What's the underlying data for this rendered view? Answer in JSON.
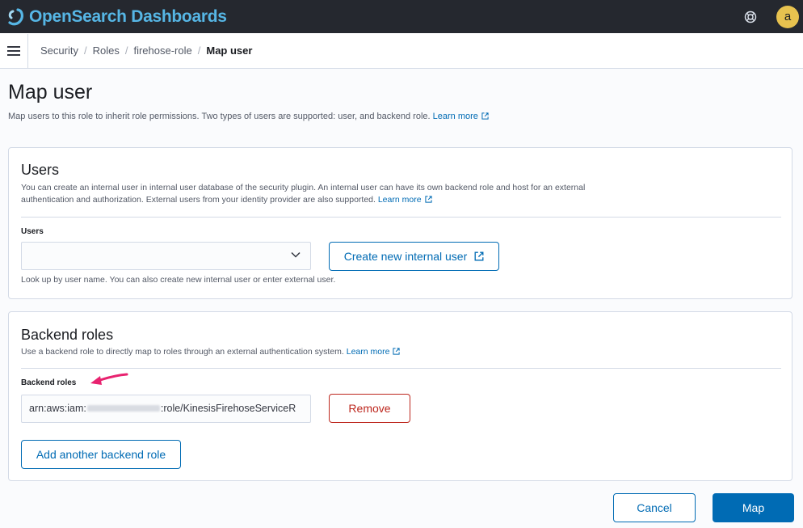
{
  "app": {
    "brand": "OpenSearch Dashboards",
    "avatar_initial": "a"
  },
  "breadcrumbs": [
    "Security",
    "Roles",
    "firehose-role",
    "Map user"
  ],
  "page": {
    "title": "Map user",
    "description": "Map users to this role to inherit role permissions. Two types of users are supported: user, and backend role.",
    "learn_more": "Learn more"
  },
  "users_panel": {
    "title": "Users",
    "description": "You can create an internal user in internal user database of the security plugin. An internal user can have its own backend role and host for an external authentication and authorization. External users from your identity provider are also supported.",
    "learn_more": "Learn more",
    "field_label": "Users",
    "combo_value": "",
    "create_button": "Create new internal user",
    "help_text": "Look up by user name. You can also create new internal user or enter external user."
  },
  "backend_panel": {
    "title": "Backend roles",
    "description": "Use a backend role to directly map to roles through an external authentication system.",
    "learn_more": "Learn more",
    "field_label": "Backend roles",
    "role_value_prefix": "arn:aws:iam:",
    "role_value_suffix": ":role/KinesisFirehoseServiceR",
    "remove_button": "Remove",
    "add_button": "Add another backend role"
  },
  "footer": {
    "cancel": "Cancel",
    "map": "Map"
  },
  "colors": {
    "accent": "#006bb4",
    "danger": "#bd271e",
    "header_bg": "#25282f",
    "annotation": "#e8226f"
  }
}
